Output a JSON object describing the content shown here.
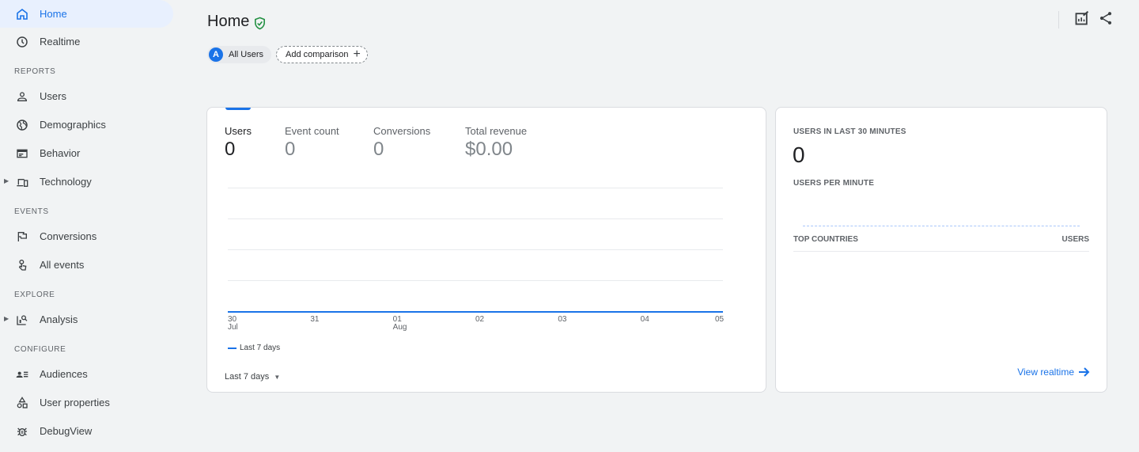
{
  "sidebar": {
    "items": [
      {
        "label": "Home",
        "icon": "home-icon",
        "active": true
      },
      {
        "label": "Realtime",
        "icon": "clock-icon"
      },
      {
        "label": "Users",
        "icon": "person-icon"
      },
      {
        "label": "Demographics",
        "icon": "globe-icon"
      },
      {
        "label": "Behavior",
        "icon": "browser-icon"
      },
      {
        "label": "Technology",
        "icon": "devices-icon"
      },
      {
        "label": "Conversions",
        "icon": "flag-icon"
      },
      {
        "label": "All events",
        "icon": "touch-icon"
      },
      {
        "label": "Analysis",
        "icon": "analysis-icon"
      },
      {
        "label": "Audiences",
        "icon": "audience-icon"
      },
      {
        "label": "User properties",
        "icon": "user-properties-icon"
      },
      {
        "label": "DebugView",
        "icon": "bug-icon"
      }
    ],
    "sections": {
      "reports": "REPORTS",
      "events": "EVENTS",
      "explore": "EXPLORE",
      "configure": "CONFIGURE"
    }
  },
  "header": {
    "title": "Home",
    "segment_avatar": "A",
    "segment_label": "All Users",
    "add_comparison": "Add comparison"
  },
  "overview": {
    "metrics": [
      {
        "label": "Users",
        "value": "0"
      },
      {
        "label": "Event count",
        "value": "0"
      },
      {
        "label": "Conversions",
        "value": "0"
      },
      {
        "label": "Total revenue",
        "value": "$0.00"
      }
    ],
    "x_ticks": [
      {
        "day": "30",
        "month": "Jul"
      },
      {
        "day": "31",
        "month": ""
      },
      {
        "day": "01",
        "month": "Aug"
      },
      {
        "day": "02",
        "month": ""
      },
      {
        "day": "03",
        "month": ""
      },
      {
        "day": "04",
        "month": ""
      },
      {
        "day": "05",
        "month": ""
      }
    ],
    "legend": "Last 7 days",
    "date_range": "Last 7 days"
  },
  "chart_data": {
    "type": "line",
    "x": [
      "30 Jul",
      "31",
      "01 Aug",
      "02",
      "03",
      "04",
      "05"
    ],
    "series": [
      {
        "name": "Last 7 days",
        "values": [
          0,
          0,
          0,
          0,
          0,
          0,
          0
        ]
      }
    ],
    "title": "",
    "xlabel": "",
    "ylabel": "",
    "grid": true,
    "legend": "bottom-left"
  },
  "realtime": {
    "users_heading": "USERS IN LAST 30 MINUTES",
    "users_value": "0",
    "per_minute_heading": "USERS PER MINUTE",
    "countries_heading": "TOP COUNTRIES",
    "users_col_heading": "USERS",
    "link": "View realtime"
  },
  "colors": {
    "accent": "#1a73e8",
    "active_bg": "#e8f0fe",
    "verified": "#1e8e3e"
  }
}
